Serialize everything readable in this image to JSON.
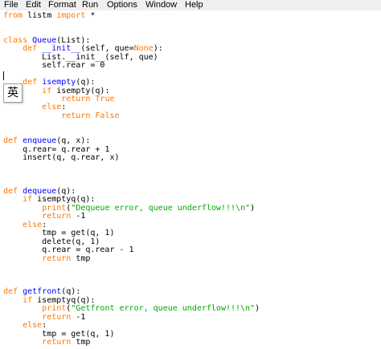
{
  "menu": [
    "File",
    "Edit",
    "Format",
    "Run",
    "Options",
    "Window",
    "Help"
  ],
  "ime_indicator": "英",
  "code_lines": [
    [
      {
        "t": "from",
        "c": "kw"
      },
      {
        "t": " listm "
      },
      {
        "t": "import",
        "c": "kw"
      },
      {
        "t": " *"
      }
    ],
    [],
    [],
    [
      {
        "t": "class",
        "c": "kw"
      },
      {
        "t": " "
      },
      {
        "t": "Queue",
        "c": "fn"
      },
      {
        "t": "(List):"
      }
    ],
    [
      {
        "t": "    "
      },
      {
        "t": "def",
        "c": "kw"
      },
      {
        "t": " "
      },
      {
        "t": "__init__",
        "c": "fn"
      },
      {
        "t": "(self, que="
      },
      {
        "t": "None",
        "c": "kw"
      },
      {
        "t": "):"
      }
    ],
    [
      {
        "t": "        List.__init__(self, que)"
      }
    ],
    [
      {
        "t": "        self.rear = 0"
      }
    ],
    [],
    [
      {
        "t": "    "
      },
      {
        "t": "def",
        "c": "kw"
      },
      {
        "t": " "
      },
      {
        "t": "isempty",
        "c": "fn"
      },
      {
        "t": "(q):"
      }
    ],
    [
      {
        "t": "        "
      },
      {
        "t": "if",
        "c": "kw"
      },
      {
        "t": " isempty(q):"
      }
    ],
    [
      {
        "t": "            "
      },
      {
        "t": "return",
        "c": "kw"
      },
      {
        "t": " "
      },
      {
        "t": "True",
        "c": "kw"
      }
    ],
    [
      {
        "t": "        "
      },
      {
        "t": "else",
        "c": "kw"
      },
      {
        "t": ":"
      }
    ],
    [
      {
        "t": "            "
      },
      {
        "t": "return",
        "c": "kw"
      },
      {
        "t": " "
      },
      {
        "t": "False",
        "c": "kw"
      }
    ],
    [],
    [],
    [
      {
        "t": "def",
        "c": "kw"
      },
      {
        "t": " "
      },
      {
        "t": "enqueue",
        "c": "fn"
      },
      {
        "t": "(q, x):"
      }
    ],
    [
      {
        "t": "    q.rear= q.rear + 1"
      }
    ],
    [
      {
        "t": "    insert(q, q.rear, x)"
      }
    ],
    [],
    [],
    [],
    [
      {
        "t": "def",
        "c": "kw"
      },
      {
        "t": " "
      },
      {
        "t": "dequeue",
        "c": "fn"
      },
      {
        "t": "(q):"
      }
    ],
    [
      {
        "t": "    "
      },
      {
        "t": "if",
        "c": "kw"
      },
      {
        "t": " isemptyq(q):"
      }
    ],
    [
      {
        "t": "        "
      },
      {
        "t": "print",
        "c": "kw"
      },
      {
        "t": "("
      },
      {
        "t": "\"Dequeue error, queue underflow!!!\\n\"",
        "c": "str"
      },
      {
        "t": ")"
      }
    ],
    [
      {
        "t": "        "
      },
      {
        "t": "return",
        "c": "kw"
      },
      {
        "t": " -1"
      }
    ],
    [
      {
        "t": "    "
      },
      {
        "t": "else",
        "c": "kw"
      },
      {
        "t": ":"
      }
    ],
    [
      {
        "t": "        tmp = get(q, 1)"
      }
    ],
    [
      {
        "t": "        delete(q, 1)"
      }
    ],
    [
      {
        "t": "        q.rear = q.rear - 1"
      }
    ],
    [
      {
        "t": "        "
      },
      {
        "t": "return",
        "c": "kw"
      },
      {
        "t": " tmp"
      }
    ],
    [],
    [],
    [],
    [
      {
        "t": "def",
        "c": "kw"
      },
      {
        "t": " "
      },
      {
        "t": "getfront",
        "c": "fn"
      },
      {
        "t": "(q):"
      }
    ],
    [
      {
        "t": "    "
      },
      {
        "t": "if",
        "c": "kw"
      },
      {
        "t": " isemptyq(q):"
      }
    ],
    [
      {
        "t": "        "
      },
      {
        "t": "print",
        "c": "kw"
      },
      {
        "t": "("
      },
      {
        "t": "\"Getfront error, queue underflow!!!\\n\"",
        "c": "str"
      },
      {
        "t": ")"
      }
    ],
    [
      {
        "t": "        "
      },
      {
        "t": "return",
        "c": "kw"
      },
      {
        "t": " -1"
      }
    ],
    [
      {
        "t": "    "
      },
      {
        "t": "else",
        "c": "kw"
      },
      {
        "t": ":"
      }
    ],
    [
      {
        "t": "        tmp = get(q, 1)"
      }
    ],
    [
      {
        "t": "        "
      },
      {
        "t": "return",
        "c": "kw"
      },
      {
        "t": " tmp"
      }
    ]
  ],
  "colors": {
    "keyword": "#ff7700",
    "definition": "#0000ff",
    "string": "#00aa00",
    "text": "#000000",
    "menubar_bg": "#f0f0f0",
    "editor_bg": "#ffffff"
  }
}
